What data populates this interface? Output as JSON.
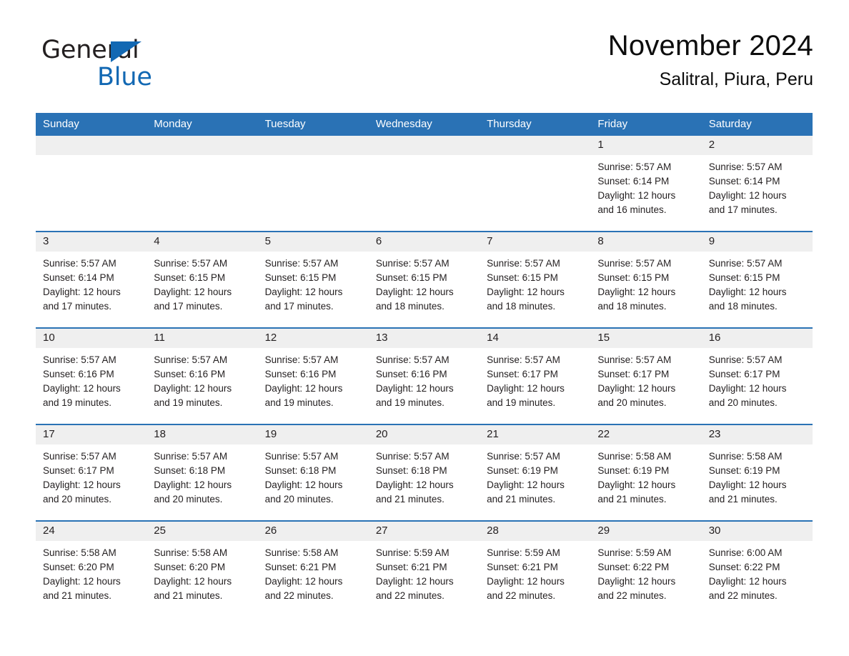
{
  "logo": {
    "part1": "General",
    "part2": "Blue",
    "triangle_color": "#1268b3"
  },
  "header": {
    "title": "November 2024",
    "subtitle": "Salitral, Piura, Peru"
  },
  "theme": {
    "header_blue": "#2a72b5",
    "daynum_gray": "#efefef",
    "text": "#231f20"
  },
  "weekday_headers": [
    "Sunday",
    "Monday",
    "Tuesday",
    "Wednesday",
    "Thursday",
    "Friday",
    "Saturday"
  ],
  "weeks": [
    [
      {
        "day": "",
        "sunrise": "",
        "sunset": "",
        "daylight_line1": "",
        "daylight_line2": ""
      },
      {
        "day": "",
        "sunrise": "",
        "sunset": "",
        "daylight_line1": "",
        "daylight_line2": ""
      },
      {
        "day": "",
        "sunrise": "",
        "sunset": "",
        "daylight_line1": "",
        "daylight_line2": ""
      },
      {
        "day": "",
        "sunrise": "",
        "sunset": "",
        "daylight_line1": "",
        "daylight_line2": ""
      },
      {
        "day": "",
        "sunrise": "",
        "sunset": "",
        "daylight_line1": "",
        "daylight_line2": ""
      },
      {
        "day": "1",
        "sunrise": "Sunrise: 5:57 AM",
        "sunset": "Sunset: 6:14 PM",
        "daylight_line1": "Daylight: 12 hours",
        "daylight_line2": "and 16 minutes."
      },
      {
        "day": "2",
        "sunrise": "Sunrise: 5:57 AM",
        "sunset": "Sunset: 6:14 PM",
        "daylight_line1": "Daylight: 12 hours",
        "daylight_line2": "and 17 minutes."
      }
    ],
    [
      {
        "day": "3",
        "sunrise": "Sunrise: 5:57 AM",
        "sunset": "Sunset: 6:14 PM",
        "daylight_line1": "Daylight: 12 hours",
        "daylight_line2": "and 17 minutes."
      },
      {
        "day": "4",
        "sunrise": "Sunrise: 5:57 AM",
        "sunset": "Sunset: 6:15 PM",
        "daylight_line1": "Daylight: 12 hours",
        "daylight_line2": "and 17 minutes."
      },
      {
        "day": "5",
        "sunrise": "Sunrise: 5:57 AM",
        "sunset": "Sunset: 6:15 PM",
        "daylight_line1": "Daylight: 12 hours",
        "daylight_line2": "and 17 minutes."
      },
      {
        "day": "6",
        "sunrise": "Sunrise: 5:57 AM",
        "sunset": "Sunset: 6:15 PM",
        "daylight_line1": "Daylight: 12 hours",
        "daylight_line2": "and 18 minutes."
      },
      {
        "day": "7",
        "sunrise": "Sunrise: 5:57 AM",
        "sunset": "Sunset: 6:15 PM",
        "daylight_line1": "Daylight: 12 hours",
        "daylight_line2": "and 18 minutes."
      },
      {
        "day": "8",
        "sunrise": "Sunrise: 5:57 AM",
        "sunset": "Sunset: 6:15 PM",
        "daylight_line1": "Daylight: 12 hours",
        "daylight_line2": "and 18 minutes."
      },
      {
        "day": "9",
        "sunrise": "Sunrise: 5:57 AM",
        "sunset": "Sunset: 6:15 PM",
        "daylight_line1": "Daylight: 12 hours",
        "daylight_line2": "and 18 minutes."
      }
    ],
    [
      {
        "day": "10",
        "sunrise": "Sunrise: 5:57 AM",
        "sunset": "Sunset: 6:16 PM",
        "daylight_line1": "Daylight: 12 hours",
        "daylight_line2": "and 19 minutes."
      },
      {
        "day": "11",
        "sunrise": "Sunrise: 5:57 AM",
        "sunset": "Sunset: 6:16 PM",
        "daylight_line1": "Daylight: 12 hours",
        "daylight_line2": "and 19 minutes."
      },
      {
        "day": "12",
        "sunrise": "Sunrise: 5:57 AM",
        "sunset": "Sunset: 6:16 PM",
        "daylight_line1": "Daylight: 12 hours",
        "daylight_line2": "and 19 minutes."
      },
      {
        "day": "13",
        "sunrise": "Sunrise: 5:57 AM",
        "sunset": "Sunset: 6:16 PM",
        "daylight_line1": "Daylight: 12 hours",
        "daylight_line2": "and 19 minutes."
      },
      {
        "day": "14",
        "sunrise": "Sunrise: 5:57 AM",
        "sunset": "Sunset: 6:17 PM",
        "daylight_line1": "Daylight: 12 hours",
        "daylight_line2": "and 19 minutes."
      },
      {
        "day": "15",
        "sunrise": "Sunrise: 5:57 AM",
        "sunset": "Sunset: 6:17 PM",
        "daylight_line1": "Daylight: 12 hours",
        "daylight_line2": "and 20 minutes."
      },
      {
        "day": "16",
        "sunrise": "Sunrise: 5:57 AM",
        "sunset": "Sunset: 6:17 PM",
        "daylight_line1": "Daylight: 12 hours",
        "daylight_line2": "and 20 minutes."
      }
    ],
    [
      {
        "day": "17",
        "sunrise": "Sunrise: 5:57 AM",
        "sunset": "Sunset: 6:17 PM",
        "daylight_line1": "Daylight: 12 hours",
        "daylight_line2": "and 20 minutes."
      },
      {
        "day": "18",
        "sunrise": "Sunrise: 5:57 AM",
        "sunset": "Sunset: 6:18 PM",
        "daylight_line1": "Daylight: 12 hours",
        "daylight_line2": "and 20 minutes."
      },
      {
        "day": "19",
        "sunrise": "Sunrise: 5:57 AM",
        "sunset": "Sunset: 6:18 PM",
        "daylight_line1": "Daylight: 12 hours",
        "daylight_line2": "and 20 minutes."
      },
      {
        "day": "20",
        "sunrise": "Sunrise: 5:57 AM",
        "sunset": "Sunset: 6:18 PM",
        "daylight_line1": "Daylight: 12 hours",
        "daylight_line2": "and 21 minutes."
      },
      {
        "day": "21",
        "sunrise": "Sunrise: 5:57 AM",
        "sunset": "Sunset: 6:19 PM",
        "daylight_line1": "Daylight: 12 hours",
        "daylight_line2": "and 21 minutes."
      },
      {
        "day": "22",
        "sunrise": "Sunrise: 5:58 AM",
        "sunset": "Sunset: 6:19 PM",
        "daylight_line1": "Daylight: 12 hours",
        "daylight_line2": "and 21 minutes."
      },
      {
        "day": "23",
        "sunrise": "Sunrise: 5:58 AM",
        "sunset": "Sunset: 6:19 PM",
        "daylight_line1": "Daylight: 12 hours",
        "daylight_line2": "and 21 minutes."
      }
    ],
    [
      {
        "day": "24",
        "sunrise": "Sunrise: 5:58 AM",
        "sunset": "Sunset: 6:20 PM",
        "daylight_line1": "Daylight: 12 hours",
        "daylight_line2": "and 21 minutes."
      },
      {
        "day": "25",
        "sunrise": "Sunrise: 5:58 AM",
        "sunset": "Sunset: 6:20 PM",
        "daylight_line1": "Daylight: 12 hours",
        "daylight_line2": "and 21 minutes."
      },
      {
        "day": "26",
        "sunrise": "Sunrise: 5:58 AM",
        "sunset": "Sunset: 6:21 PM",
        "daylight_line1": "Daylight: 12 hours",
        "daylight_line2": "and 22 minutes."
      },
      {
        "day": "27",
        "sunrise": "Sunrise: 5:59 AM",
        "sunset": "Sunset: 6:21 PM",
        "daylight_line1": "Daylight: 12 hours",
        "daylight_line2": "and 22 minutes."
      },
      {
        "day": "28",
        "sunrise": "Sunrise: 5:59 AM",
        "sunset": "Sunset: 6:21 PM",
        "daylight_line1": "Daylight: 12 hours",
        "daylight_line2": "and 22 minutes."
      },
      {
        "day": "29",
        "sunrise": "Sunrise: 5:59 AM",
        "sunset": "Sunset: 6:22 PM",
        "daylight_line1": "Daylight: 12 hours",
        "daylight_line2": "and 22 minutes."
      },
      {
        "day": "30",
        "sunrise": "Sunrise: 6:00 AM",
        "sunset": "Sunset: 6:22 PM",
        "daylight_line1": "Daylight: 12 hours",
        "daylight_line2": "and 22 minutes."
      }
    ]
  ]
}
